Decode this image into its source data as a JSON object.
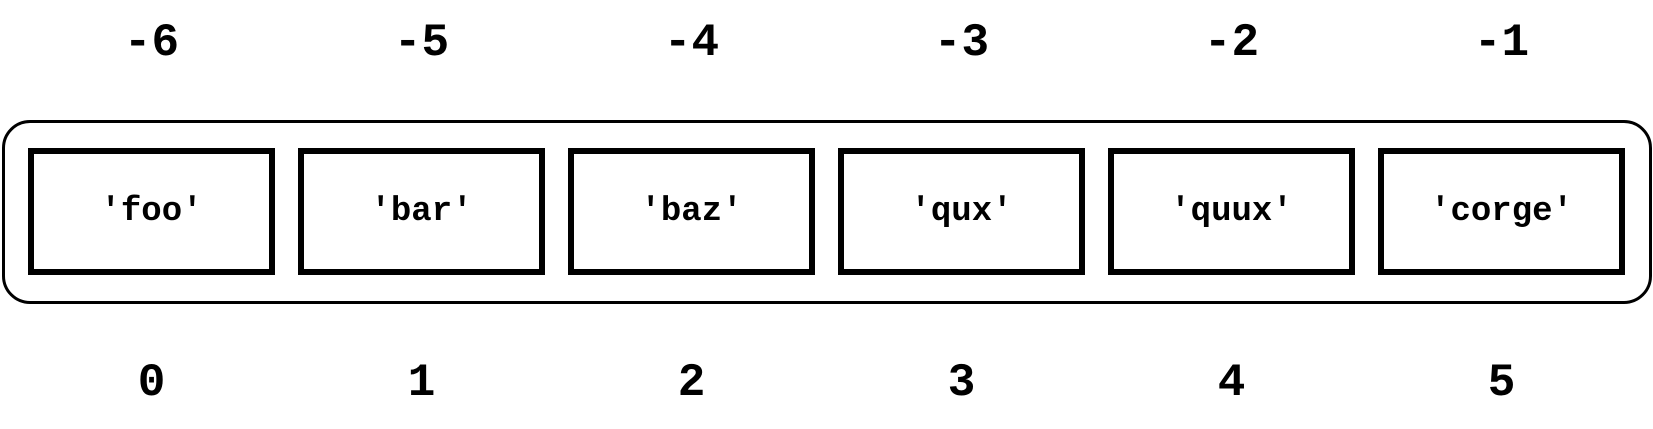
{
  "items": [
    "'foo'",
    "'bar'",
    "'baz'",
    "'qux'",
    "'quux'",
    "'corge'"
  ],
  "negative_indices": [
    "-6",
    "-5",
    "-4",
    "-3",
    "-2",
    "-1"
  ],
  "positive_indices": [
    "0",
    "1",
    "2",
    "3",
    "4",
    "5"
  ]
}
